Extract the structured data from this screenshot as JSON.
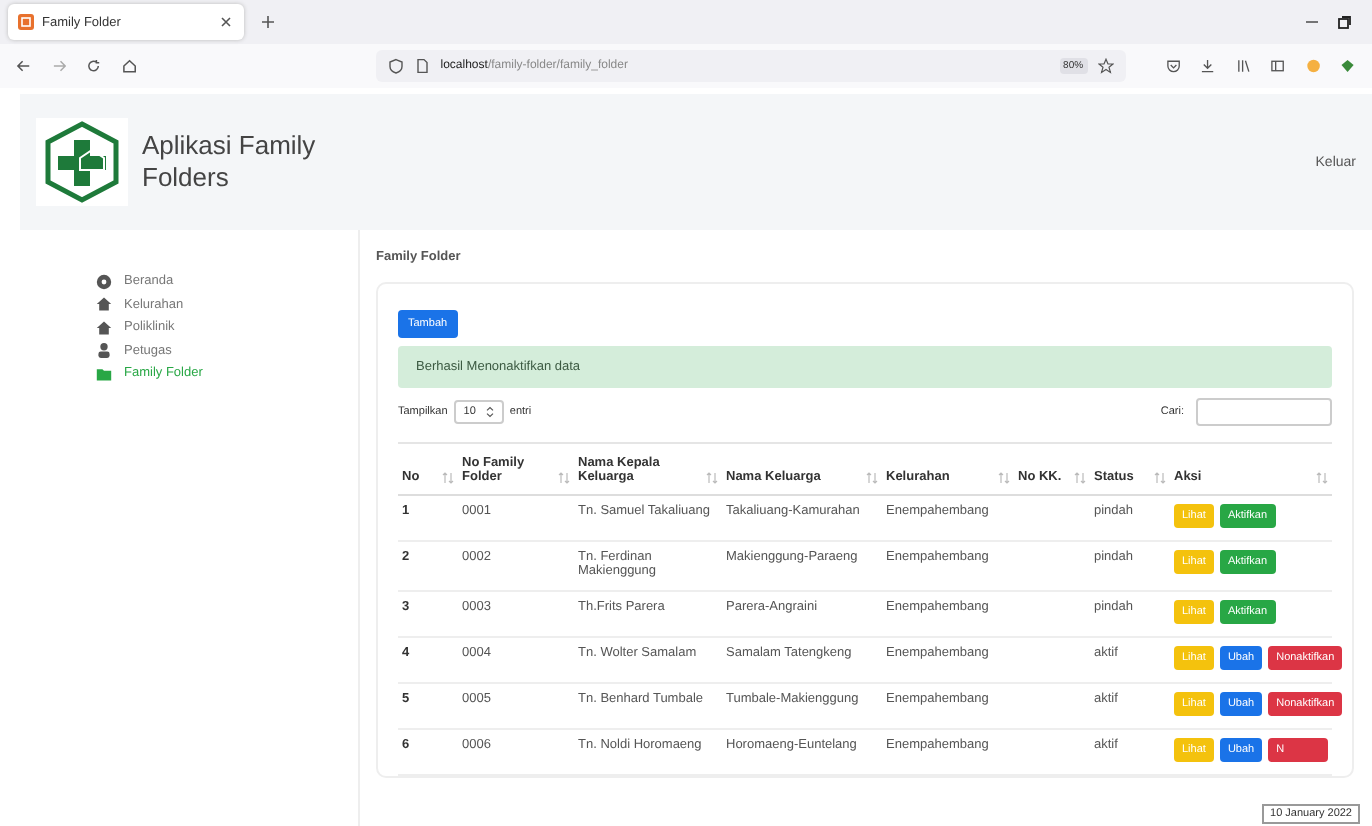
{
  "browser": {
    "tab_title": "Family Folder",
    "url_host": "localhost",
    "url_path": "/family-folder/family_folder",
    "zoom": "80%"
  },
  "header": {
    "app_name": "Aplikasi Family Folders",
    "logout": "Keluar"
  },
  "sidebar": {
    "items": [
      {
        "label": "Beranda",
        "kind": "dashboard",
        "selected": false
      },
      {
        "label": "Kelurahan",
        "kind": "home",
        "selected": false
      },
      {
        "label": "Poliklinik",
        "kind": "home",
        "selected": false
      },
      {
        "label": "Petugas",
        "kind": "user",
        "selected": false
      },
      {
        "label": "Family Folder",
        "kind": "folder",
        "selected": true
      }
    ]
  },
  "page_title": "Family Folder",
  "add_button": "Tambah",
  "alert": "Berhasil Menonaktifkan data",
  "length": {
    "prefix": "Tampilkan",
    "value": "10",
    "suffix": "entri"
  },
  "search": {
    "label": "Cari:"
  },
  "table": {
    "columns": [
      "No",
      "No Family Folder",
      "Nama Kepala Keluarga",
      "Nama Keluarga",
      "Kelurahan",
      "No KK.",
      "Status",
      "Aksi"
    ],
    "rows": [
      {
        "cells": [
          "1",
          "0001",
          "Tn. Samuel Takaliuang",
          "Takaliuang-Kamurahan",
          "Enempahembang",
          "",
          "pindah"
        ],
        "actions": [
          {
            "kind": "view",
            "label": "Lihat"
          },
          {
            "kind": "activate",
            "label": "Aktifkan"
          }
        ]
      },
      {
        "cells": [
          "2",
          "0002",
          "Tn. Ferdinan Makienggung",
          "Makienggung-Paraeng",
          "Enempahembang",
          "",
          "pindah"
        ],
        "actions": [
          {
            "kind": "view",
            "label": "Lihat"
          },
          {
            "kind": "activate",
            "label": "Aktifkan"
          }
        ]
      },
      {
        "cells": [
          "3",
          "0003",
          "Th.Frits Parera",
          "Parera-Angraini",
          "Enempahembang",
          "",
          "pindah"
        ],
        "actions": [
          {
            "kind": "view",
            "label": "Lihat"
          },
          {
            "kind": "activate",
            "label": "Aktifkan"
          }
        ]
      },
      {
        "cells": [
          "4",
          "0004",
          "Tn. Wolter Samalam",
          "Samalam Tatengkeng",
          "Enempahembang",
          "",
          "aktif"
        ],
        "actions": [
          {
            "kind": "view",
            "label": "Lihat"
          },
          {
            "kind": "edit",
            "label": "Ubah"
          },
          {
            "kind": "deactivate",
            "label": "Nonaktifkan"
          }
        ]
      },
      {
        "cells": [
          "5",
          "0005",
          "Tn. Benhard Tumbale",
          "Tumbale-Makienggung",
          "Enempahembang",
          "",
          "aktif"
        ],
        "actions": [
          {
            "kind": "view",
            "label": "Lihat"
          },
          {
            "kind": "edit",
            "label": "Ubah"
          },
          {
            "kind": "deactivate",
            "label": "Nonaktifkan"
          }
        ]
      },
      {
        "cells": [
          "6",
          "0006",
          "Tn. Noldi Horomaeng",
          "Horomaeng-Euntelang",
          "Enempahembang",
          "",
          "aktif"
        ],
        "actions": [
          {
            "kind": "view",
            "label": "Lihat"
          },
          {
            "kind": "edit",
            "label": "Ubah"
          },
          {
            "kind": "deactivate",
            "label": "N"
          }
        ]
      }
    ]
  },
  "tooltip": "10 January 2022"
}
